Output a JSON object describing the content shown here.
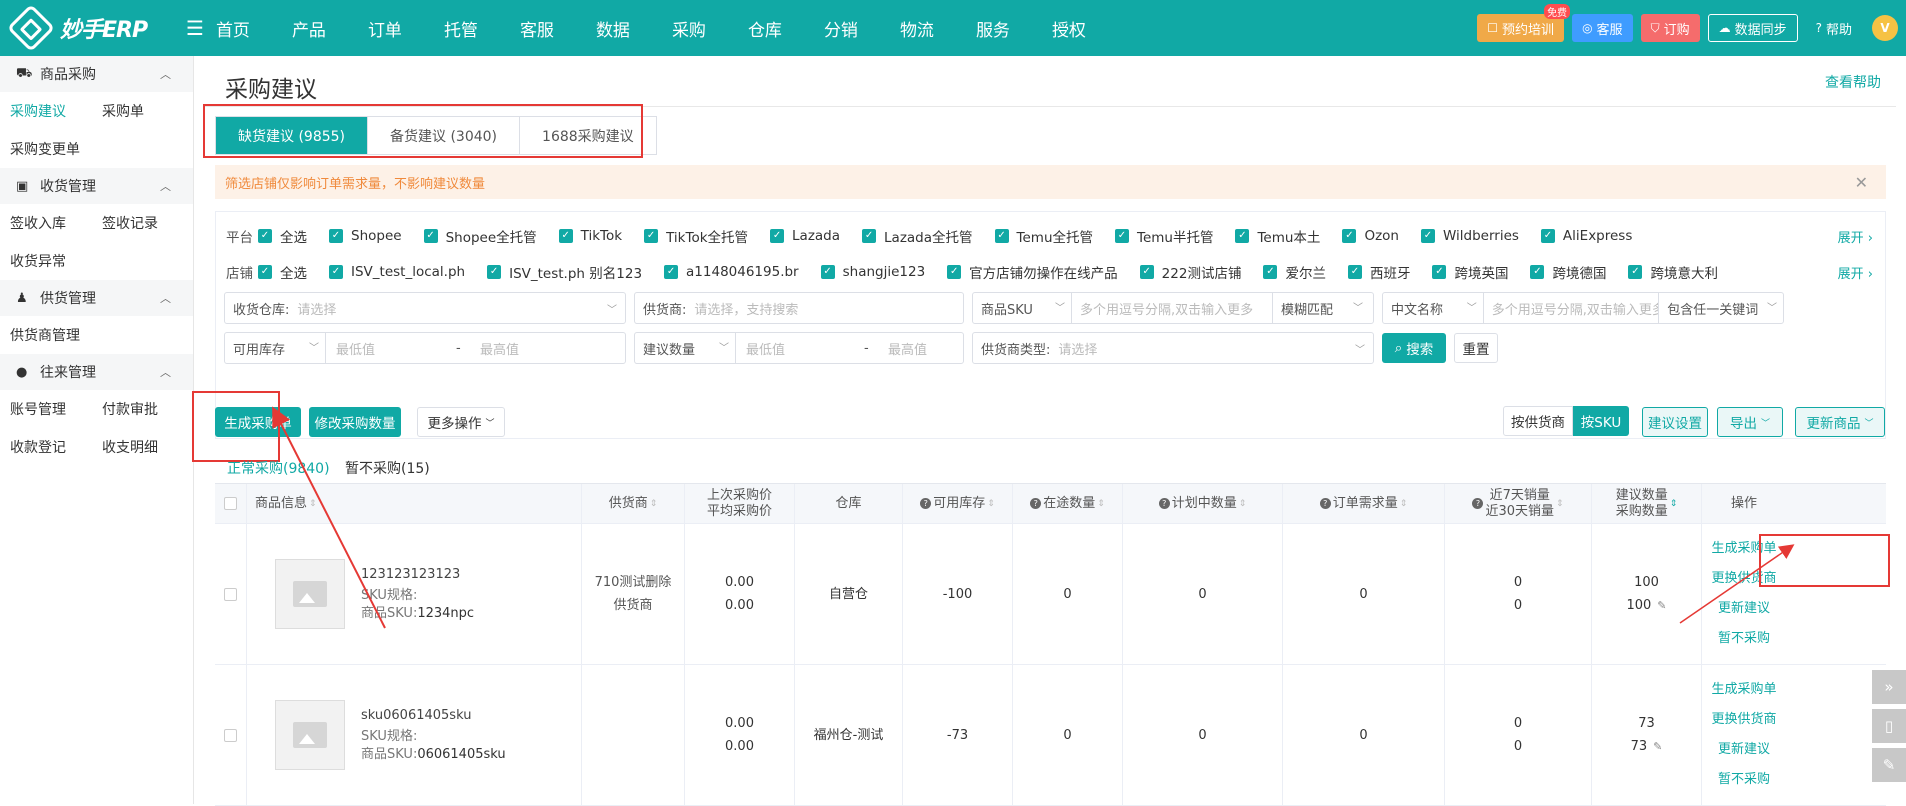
{
  "app": {
    "logo_text": "妙手ERP"
  },
  "nav": {
    "items": [
      {
        "label": "首页",
        "dot": false
      },
      {
        "label": "产品",
        "dot": false
      },
      {
        "label": "订单",
        "dot": true
      },
      {
        "label": "托管",
        "dot": false
      },
      {
        "label": "客服",
        "dot": true
      },
      {
        "label": "数据",
        "dot": false
      },
      {
        "label": "采购",
        "dot": false
      },
      {
        "label": "仓库",
        "dot": true
      },
      {
        "label": "分销",
        "dot": true
      },
      {
        "label": "物流",
        "dot": false
      },
      {
        "label": "服务",
        "dot": false
      },
      {
        "label": "授权",
        "dot": false
      }
    ]
  },
  "topright": {
    "training": "预约培训",
    "free_badge": "免费",
    "service": "客服",
    "order": "订购",
    "sync": "数据同步",
    "help": "帮助",
    "avatar": "V"
  },
  "sidebar": {
    "groups": [
      {
        "label": "商品采购",
        "icon": "cart-icon",
        "rows": [
          [
            "采购建议",
            "采购单"
          ],
          [
            "采购变更单"
          ]
        ]
      },
      {
        "label": "收货管理",
        "icon": "clipboard-icon",
        "rows": [
          [
            "签收入库",
            "签收记录"
          ],
          [
            "收货异常"
          ]
        ]
      },
      {
        "label": "供货管理",
        "icon": "supplier-icon",
        "rows": [
          [
            "供货商管理"
          ]
        ]
      },
      {
        "label": "往来管理",
        "icon": "user-icon",
        "rows": [
          [
            "账号管理",
            "付款审批"
          ],
          [
            "收款登记",
            "收支明细"
          ]
        ]
      }
    ],
    "active": "采购建议"
  },
  "page": {
    "title": "采购建议",
    "help_link": "查看帮助",
    "tabs": [
      "缺货建议 (9855)",
      "备货建议 (3040)",
      "1688采购建议"
    ],
    "alert": "筛选店铺仅影响订单需求量，不影响建议数量"
  },
  "filter": {
    "platform_label": "平台",
    "platforms": [
      "全选",
      "Shopee",
      "Shopee全托管",
      "TikTok",
      "TikTok全托管",
      "Lazada",
      "Lazada全托管",
      "Temu全托管",
      "Temu半托管",
      "Temu本土",
      "Ozon",
      "Wildberries",
      "AliExpress"
    ],
    "store_label": "店铺",
    "stores": [
      "全选",
      "ISV_test_local.ph",
      "ISV_test.ph 别名123",
      "a1148046195.br",
      "shangjie123",
      "官方店铺勿操作在线产品",
      "222测试店铺",
      "爱尔兰",
      "西班牙",
      "跨境英国",
      "跨境德国",
      "跨境意大利"
    ],
    "expand": "展开 ›",
    "warehouse_label": "收货仓库:",
    "warehouse_ph": "请选择",
    "supplier_label": "供货商:",
    "supplier_ph": "请选择，支持搜索",
    "sku_type": "商品SKU",
    "sku_ph": "多个用逗号分隔,双击输入更多",
    "match_mode": "模糊匹配",
    "name_type": "中文名称",
    "name_ph": "多个用逗号分隔,双击输入更多",
    "keyword_mode": "包含任一关键词",
    "stock_type": "可用库存",
    "min_ph": "最低值",
    "range_sep": "-",
    "max_ph": "最高值",
    "qty_type": "建议数量",
    "supplier_type_label": "供货商类型:",
    "supplier_type_ph": "请选择",
    "search": "搜索",
    "reset": "重置"
  },
  "actions": {
    "generate": "生成采购单",
    "modify_qty": "修改采购数量",
    "more": "更多操作",
    "by_supplier": "按供货商",
    "by_sku": "按SKU",
    "settings": "建议设置",
    "export": "导出",
    "update_products": "更新商品"
  },
  "subtabs": [
    "正常采购(9840)",
    "暂不采购(15)"
  ],
  "table": {
    "headers": {
      "product": "商品信息",
      "supplier": "供货商",
      "price_top": "上次采购价",
      "price_bottom": "平均采购价",
      "warehouse": "仓库",
      "stock": "可用库存",
      "transit": "在途数量",
      "plan": "计划中数量",
      "demand": "订单需求量",
      "sales_top": "近7天销量",
      "sales_bottom": "近30天销量",
      "qty_top": "建议数量",
      "qty_bottom": "采购数量",
      "ops": "操作"
    },
    "spec_label": "SKU规格:",
    "sku_label": "商品SKU:",
    "rows": [
      {
        "code": "123123123123",
        "sku": "1234npc",
        "supplier": [
          "710测试删除",
          "供货商"
        ],
        "price": [
          "0.00",
          "0.00"
        ],
        "warehouse": "自营仓",
        "stock": "-100",
        "transit": "0",
        "plan": "0",
        "demand": "0",
        "sales": [
          "0",
          "0"
        ],
        "qty": [
          "100",
          "100"
        ]
      },
      {
        "code": "sku06061405sku",
        "sku": "06061405sku",
        "supplier": [
          "",
          ""
        ],
        "price": [
          "0.00",
          "0.00"
        ],
        "warehouse": "福州仓-测试",
        "stock": "-73",
        "transit": "0",
        "plan": "0",
        "demand": "0",
        "sales": [
          "0",
          "0"
        ],
        "qty": [
          "73",
          "73"
        ]
      }
    ],
    "ops": [
      "生成采购单",
      "更换供货商",
      "更新建议",
      "暂不采购"
    ]
  },
  "colors": {
    "primary": "#11a9a5",
    "annotation": "#e53935"
  }
}
